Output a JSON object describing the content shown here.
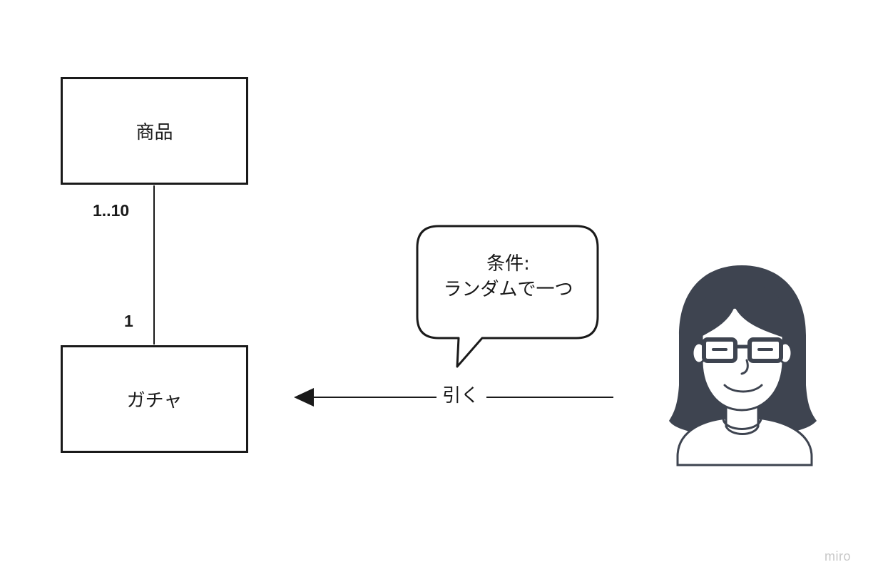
{
  "diagram": {
    "entities": {
      "product": {
        "label": "商品"
      },
      "gacha": {
        "label": "ガチャ"
      }
    },
    "association": {
      "multiplicity_product_end": "1..10",
      "multiplicity_gacha_end": "1"
    },
    "action": {
      "label": "引く"
    },
    "speech_bubble": {
      "line1": "条件:",
      "line2": "ランダムで一つ"
    },
    "actor": {
      "icon": "woman-with-glasses-avatar-icon"
    }
  },
  "watermark": "miro",
  "colors": {
    "stroke": "#1a1a1a",
    "avatar_hair": "#3e4450",
    "watermark": "#c8c8c8"
  }
}
